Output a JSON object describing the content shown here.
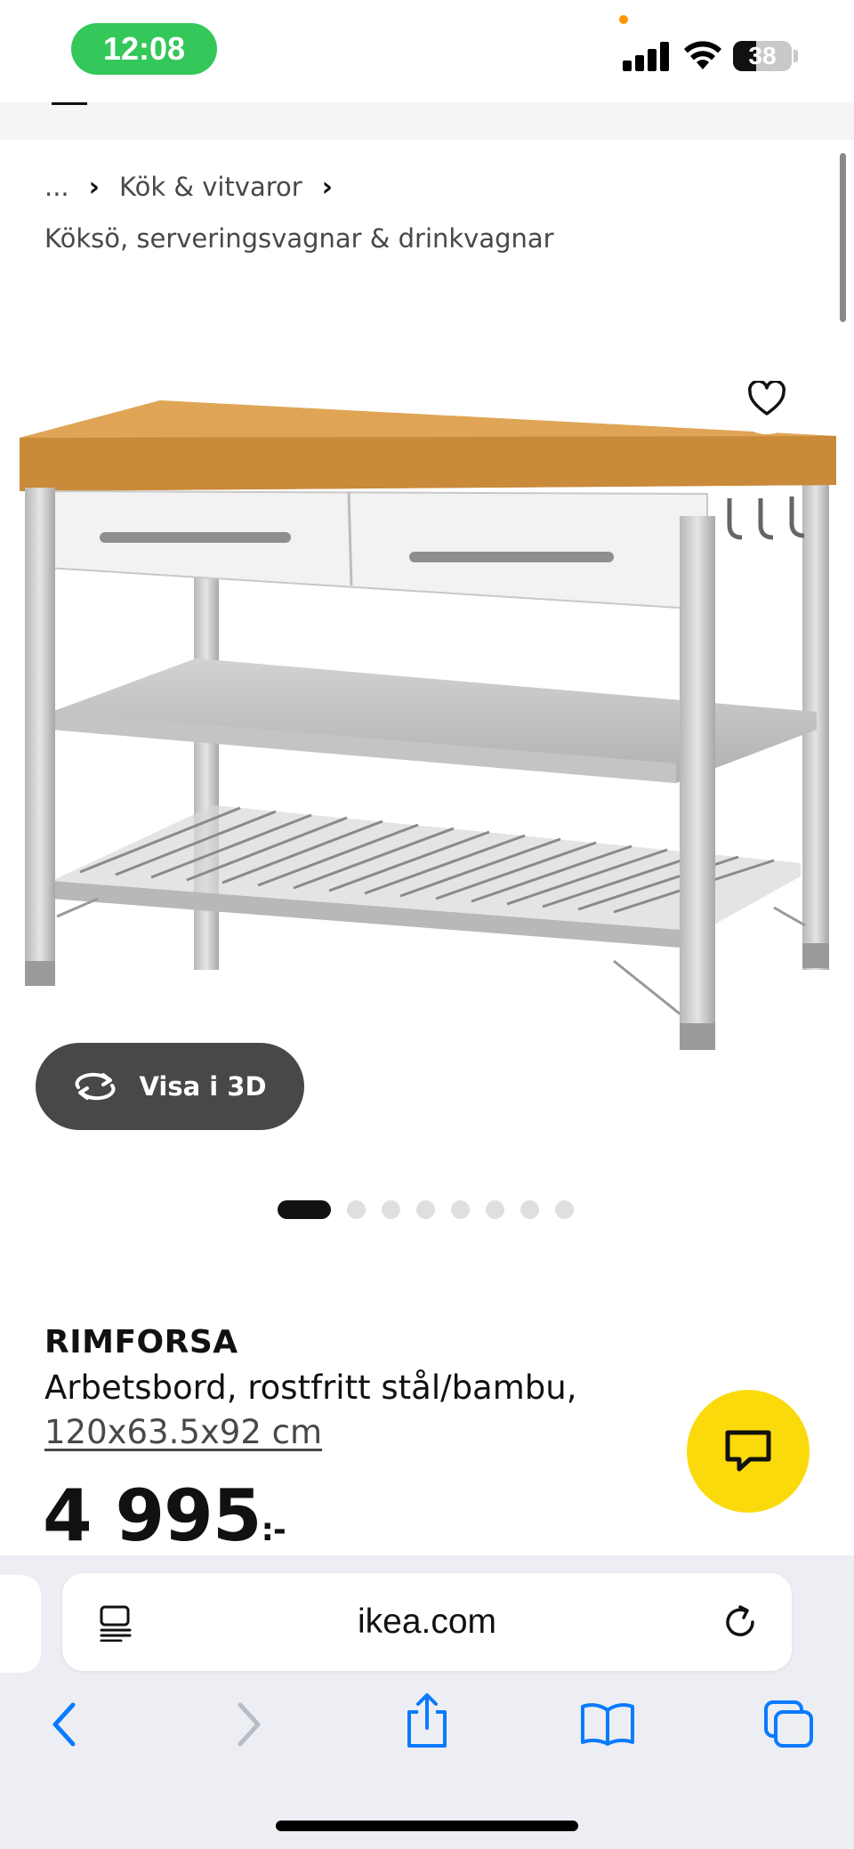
{
  "status_bar": {
    "time": "12:08",
    "battery": "38"
  },
  "breadcrumb": {
    "ellipsis": "...",
    "category": "Kök & vitvaror",
    "subcategory": "Köksö, serveringsvagnar & drinkvagnar"
  },
  "gallery": {
    "view_3d_label": "Visa i 3D",
    "dot_count": 8,
    "active_index": 0
  },
  "product": {
    "name": "RIMFORSA",
    "description": "Arbetsbord, rostfritt stål/bambu,",
    "size": "120x63.5x92 cm",
    "price": "4 995",
    "price_suffix": ":-"
  },
  "browser": {
    "url": "ikea.com"
  },
  "colors": {
    "time_pill": "#34c759",
    "chat_button": "#fada0a",
    "safari_blue": "#0a7aff",
    "view_3d_bg": "#484848"
  }
}
